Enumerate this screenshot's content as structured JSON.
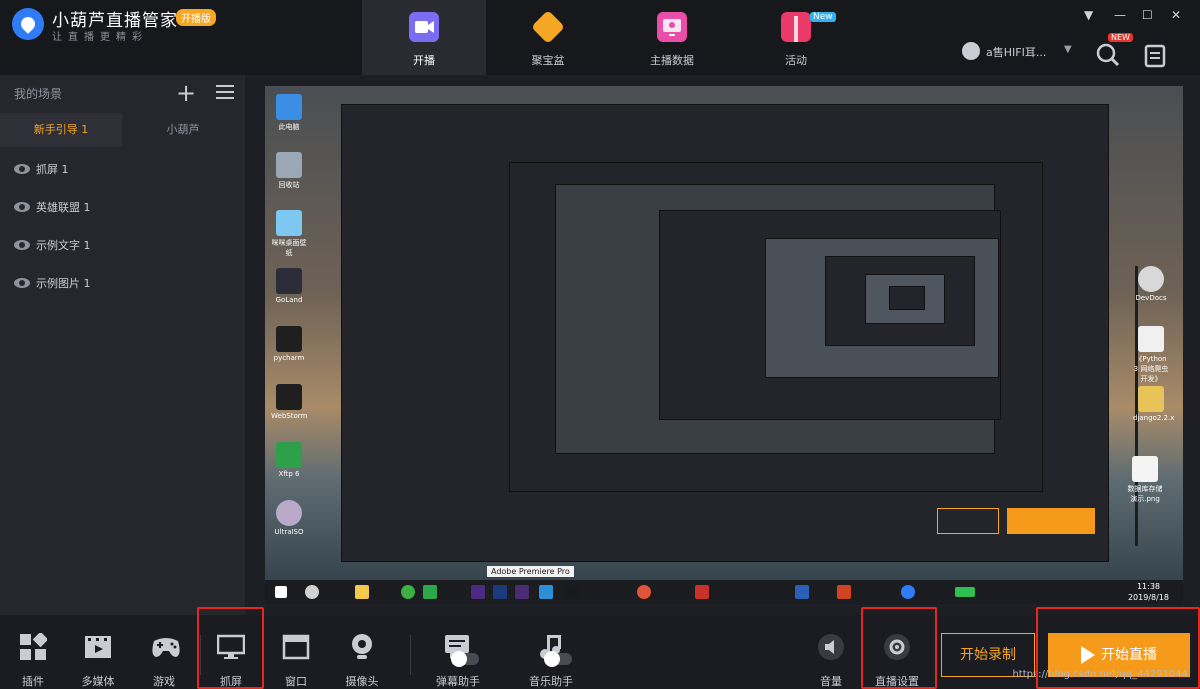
{
  "app": {
    "title": "小葫芦直播管家",
    "badge": "开播版",
    "subtitle": "让直播更精彩"
  },
  "nav": [
    {
      "label": "开播",
      "icon": "video-camera-icon",
      "color": "#7b6df2",
      "active": true
    },
    {
      "label": "聚宝盆",
      "icon": "treasure-bowl-icon",
      "color": "#f5a623",
      "active": false
    },
    {
      "label": "主播数据",
      "icon": "monitor-stats-icon",
      "color": "#e94ea8",
      "active": false
    },
    {
      "label": "活动",
      "icon": "gift-icon",
      "color": "#e93a6a",
      "active": false,
      "tag": "New"
    }
  ],
  "user": {
    "name": "a售HIFI耳...",
    "tag": "NEW"
  },
  "sidebar": {
    "title": "我的场景",
    "tabs": [
      "新手引导 1",
      "小葫芦"
    ],
    "scenes": [
      "抓屏 1",
      "英雄联盟 1",
      "示例文字 1",
      "示例图片 1"
    ]
  },
  "preview": {
    "tooltip": "Adobe Premiere Pro",
    "clock_time": "11:38",
    "clock_date": "2019/8/18",
    "desktop_icons_left": [
      "此电脑",
      "回收站",
      "咪咪桌面壁纸",
      "GoLand",
      "pycharm",
      "WebStorm",
      "Xftp 6",
      "UltraISO"
    ],
    "desktop_icons_right": [
      "DevDocs",
      "《Python 3 网络爬虫开发》",
      "django2.2.x",
      "数据库存储演示.png"
    ]
  },
  "bottom": {
    "tools": [
      "插件",
      "多媒体",
      "游戏",
      "抓屏",
      "窗口",
      "摄像头",
      "弹幕助手",
      "音乐助手"
    ],
    "volume_label": "音量",
    "settings_label": "直播设置",
    "record_label": "开始录制",
    "live_label": "开始直播",
    "watermark": "https://blog.csdn.net/qq_44291044"
  },
  "colors": {
    "accent": "#f5a623",
    "live_button": "#f59a1a",
    "highlight_box": "#e5291f"
  }
}
